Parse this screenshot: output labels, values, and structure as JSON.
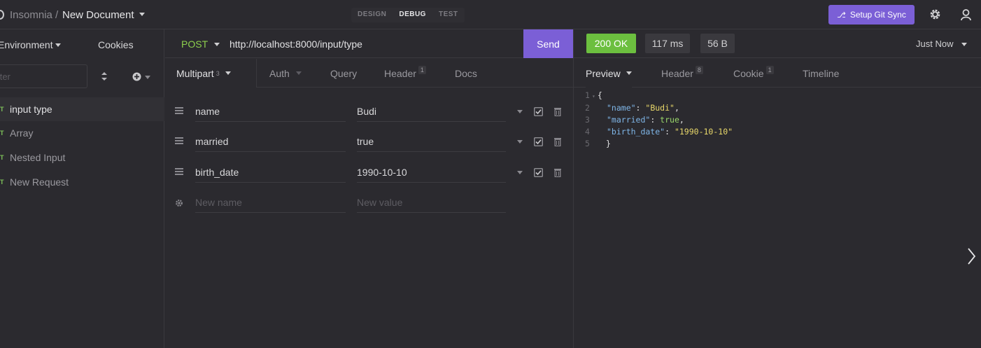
{
  "header": {
    "app_name": "Insomnia",
    "separator": "/",
    "document": "New Document",
    "mode_tabs": [
      {
        "label": "DESIGN",
        "active": false
      },
      {
        "label": "DEBUG",
        "active": true
      },
      {
        "label": "TEST",
        "active": false
      }
    ],
    "git_sync_label": "Setup Git Sync"
  },
  "sidebar": {
    "environment_label": "Environment",
    "cookies_label": "Cookies",
    "filter_placeholder": "Filter",
    "items": [
      {
        "method": "T",
        "label": "input type",
        "active": true
      },
      {
        "method": "T",
        "label": "Array",
        "active": false
      },
      {
        "method": "T",
        "label": "Nested Input",
        "active": false
      },
      {
        "method": "T",
        "label": "New Request",
        "active": false
      }
    ]
  },
  "request": {
    "method": "POST",
    "url": "http://localhost:8000/input/type",
    "send_label": "Send",
    "tabs": [
      {
        "label": "Multipart",
        "badge": "3"
      },
      {
        "label": "Auth",
        "badge": ""
      },
      {
        "label": "Query",
        "badge": ""
      },
      {
        "label": "Header",
        "badge": "1"
      },
      {
        "label": "Docs",
        "badge": ""
      }
    ],
    "params": [
      {
        "name": "name",
        "value": "Budi"
      },
      {
        "name": "married",
        "value": "true"
      },
      {
        "name": "birth_date",
        "value": "1990-10-10"
      }
    ],
    "new_name_placeholder": "New name",
    "new_value_placeholder": "New value"
  },
  "response": {
    "status": "200 OK",
    "time": "117 ms",
    "size": "56 B",
    "timestamp": "Just Now",
    "tabs": [
      {
        "label": "Preview",
        "badge": ""
      },
      {
        "label": "Header",
        "badge": "8"
      },
      {
        "label": "Cookie",
        "badge": "1"
      },
      {
        "label": "Timeline",
        "badge": ""
      }
    ],
    "lines": [
      {
        "n": "1",
        "text": "{"
      },
      {
        "n": "2",
        "key": "\"name\"",
        "value": "\"Budi\"",
        "comma": ","
      },
      {
        "n": "3",
        "key": "\"married\"",
        "value": "true",
        "comma": ","
      },
      {
        "n": "4",
        "key": "\"birth_date\"",
        "value": "\"1990-10-10\"",
        "comma": ""
      },
      {
        "n": "5",
        "text": "}"
      }
    ]
  },
  "colors": {
    "accent": "#7b5fd6",
    "status_ok": "#6cbf3f",
    "method_post": "#8ccf4d"
  }
}
